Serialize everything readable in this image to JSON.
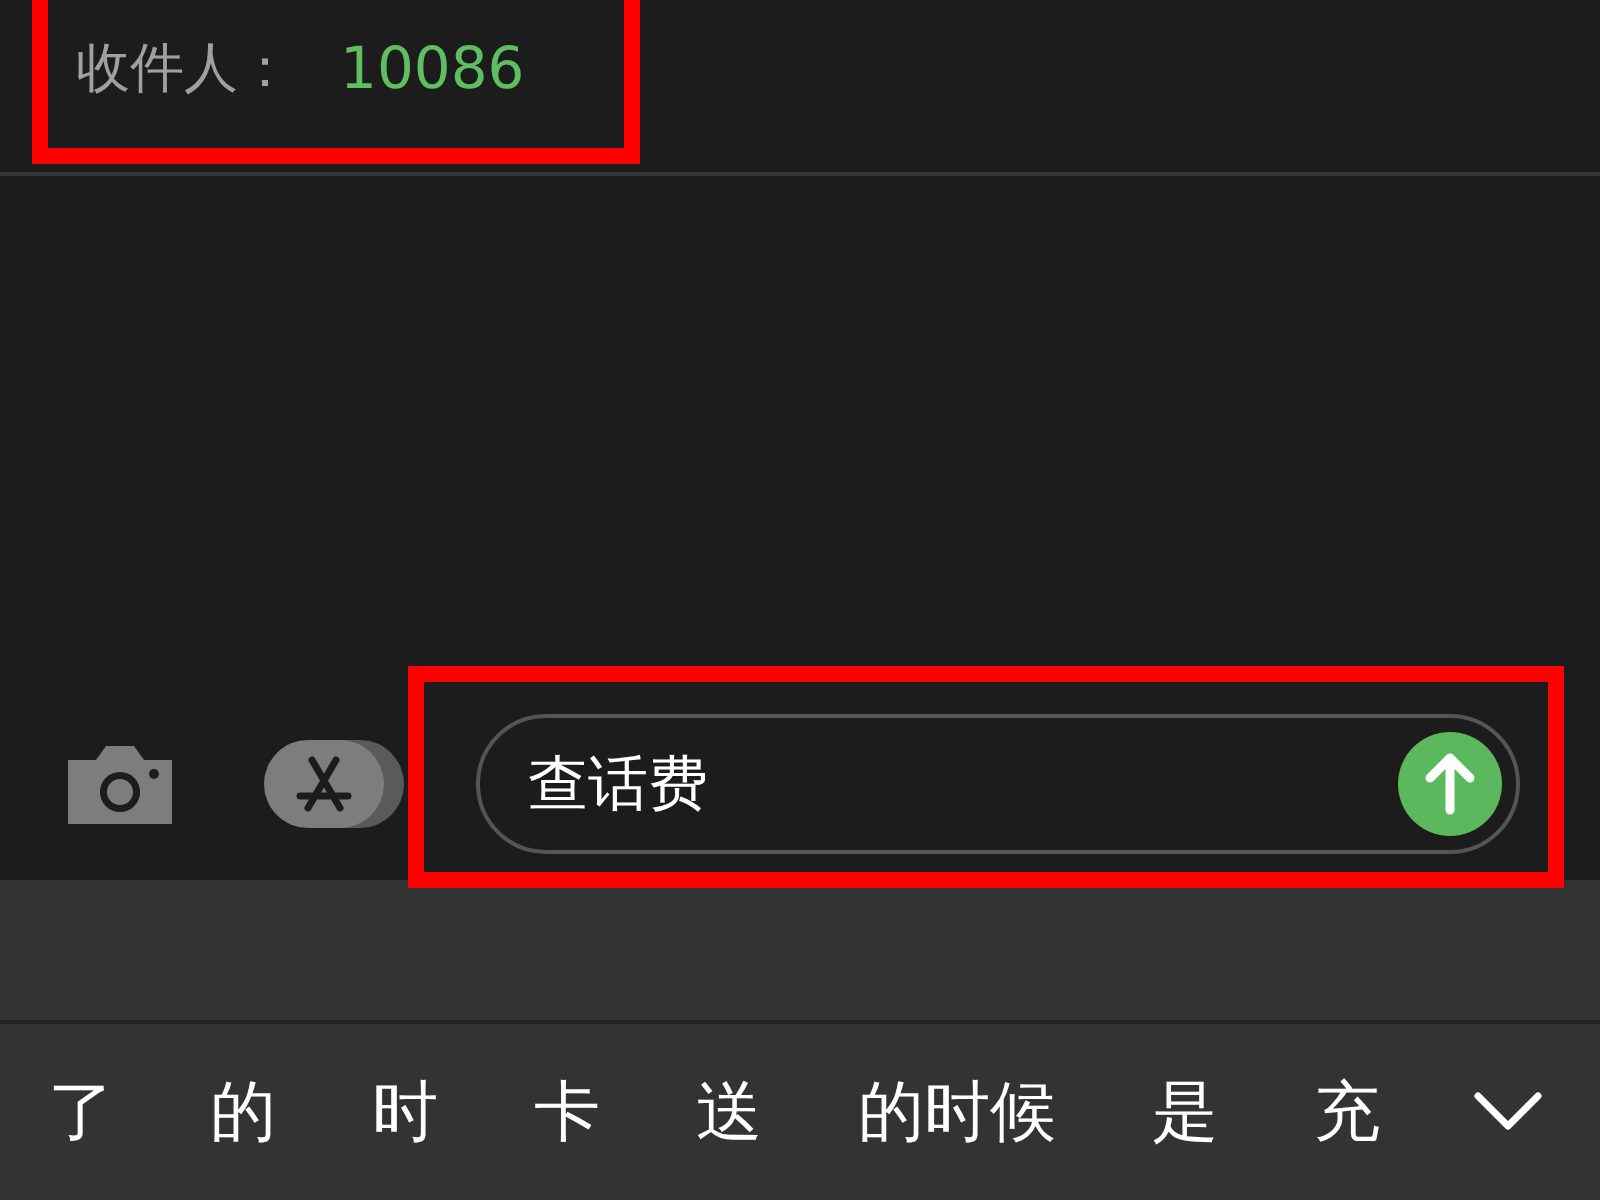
{
  "recipient": {
    "label": "收件人：",
    "value": "10086",
    "highlighted": true
  },
  "composer": {
    "value": "查话费",
    "highlighted": true
  },
  "candidates": [
    {
      "text": "了"
    },
    {
      "text": "的"
    },
    {
      "text": "时"
    },
    {
      "text": "卡"
    },
    {
      "text": "送"
    },
    {
      "text": "的时候"
    },
    {
      "text": "是"
    },
    {
      "text": "充"
    }
  ]
}
